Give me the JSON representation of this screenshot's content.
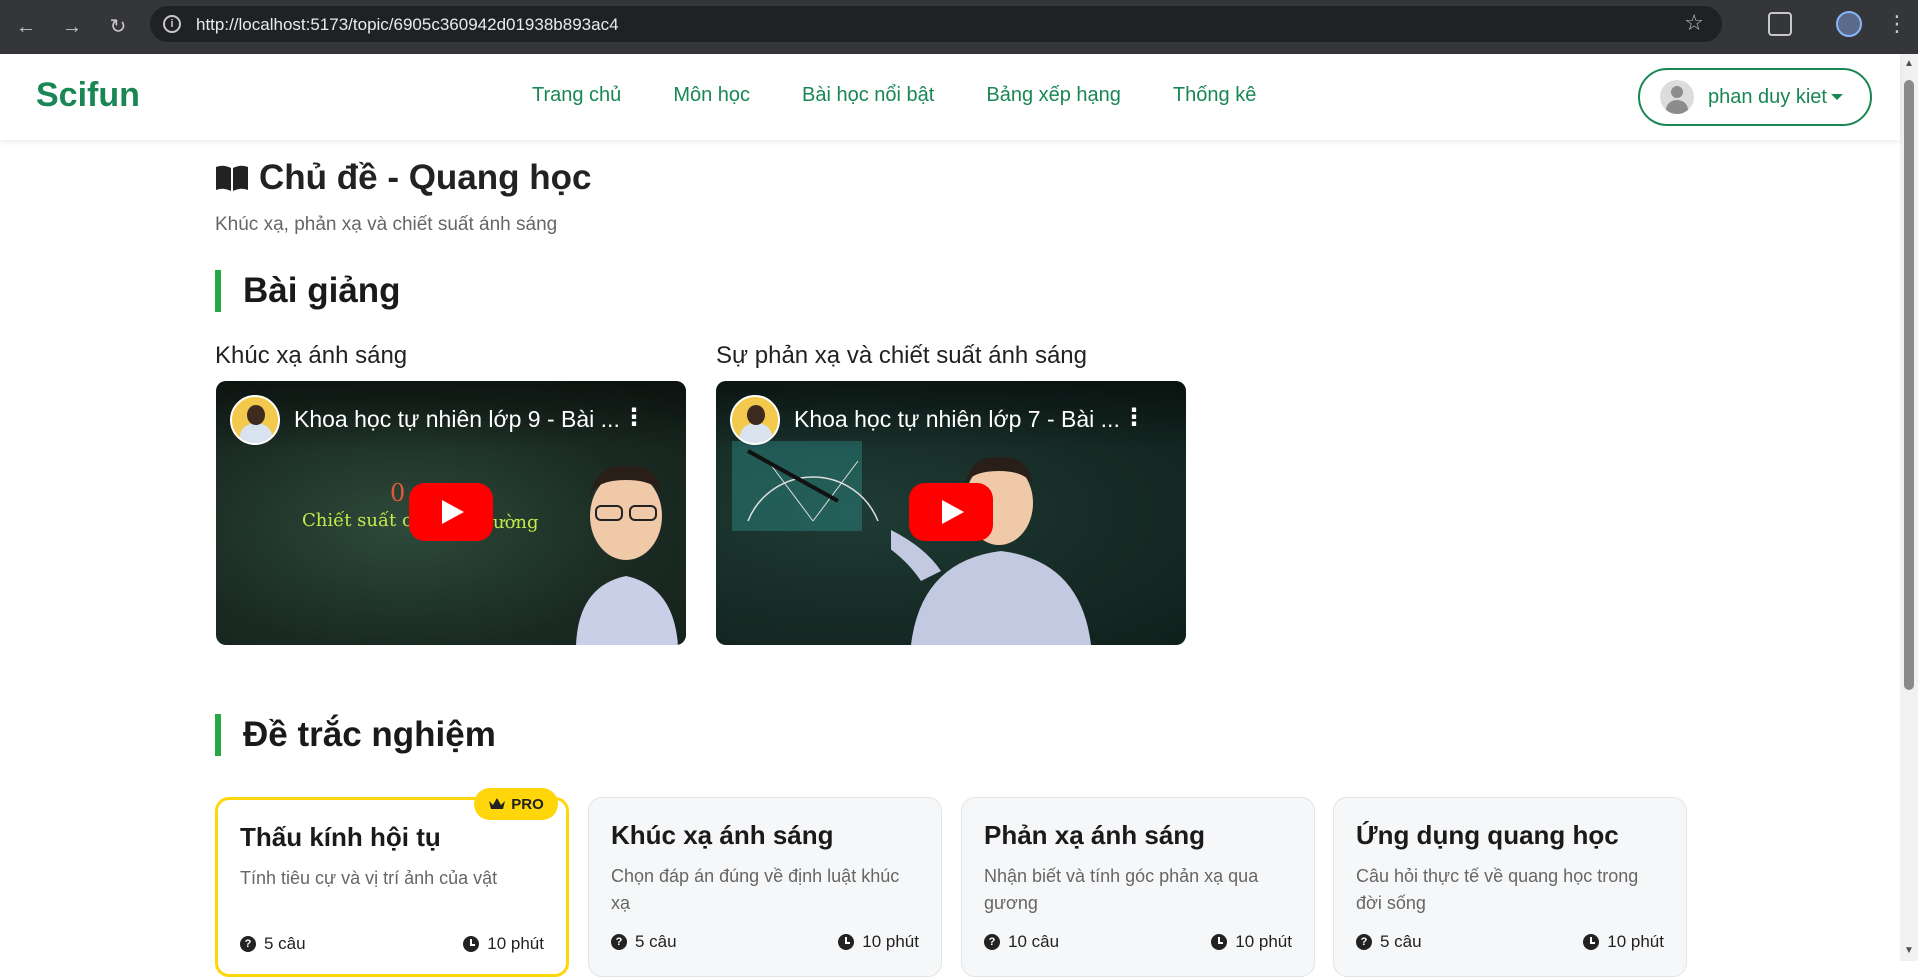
{
  "browser": {
    "url": "http://localhost:5173/topic/6905c360942d01938b893ac4",
    "back_icon": "arrow-left",
    "forward_icon": "arrow-right",
    "reload_icon": "reload"
  },
  "navbar": {
    "brand": "Scifun",
    "links": [
      "Trang chủ",
      "Môn học",
      "Bài học nổi bật",
      "Bảng xếp hạng",
      "Thống kê"
    ],
    "user_name": "phan duy kiet",
    "accent_color": "#198754"
  },
  "topic": {
    "title": "Chủ đề - Quang học",
    "subtitle": "Khúc xạ, phản xạ và chiết suất ánh sáng"
  },
  "lectures": {
    "heading": "Bài giảng",
    "videos": [
      {
        "label": "Khúc xạ ánh sáng",
        "youtube_title": "Khoa học tự nhiên lớp 9 - Bài ...",
        "overlay_text": "Chiết suất củ",
        "overlay_text2": "ường"
      },
      {
        "label": "Sự phản xạ và chiết suất ánh sáng",
        "youtube_title": "Khoa học tự nhiên lớp 7 - Bài ..."
      }
    ]
  },
  "quizzes": {
    "heading": "Đề trắc nghiệm",
    "pro_label": "PRO",
    "cards": [
      {
        "title": "Thấu kính hội tụ",
        "desc": "Tính tiêu cự và vị trí ảnh của vật",
        "questions": "5 câu",
        "time": "10 phút",
        "pro": true
      },
      {
        "title": "Khúc xạ ánh sáng",
        "desc": "Chọn đáp án đúng về định luật khúc xạ",
        "questions": "5 câu",
        "time": "10 phút",
        "pro": false
      },
      {
        "title": "Phản xạ ánh sáng",
        "desc": "Nhận biết và tính góc phản xạ qua gương",
        "questions": "10 câu",
        "time": "10 phút",
        "pro": false
      },
      {
        "title": "Ứng dụng quang học",
        "desc": "Câu hỏi thực tế về quang học trong đời sống",
        "questions": "5 câu",
        "time": "10 phút",
        "pro": false
      }
    ]
  }
}
